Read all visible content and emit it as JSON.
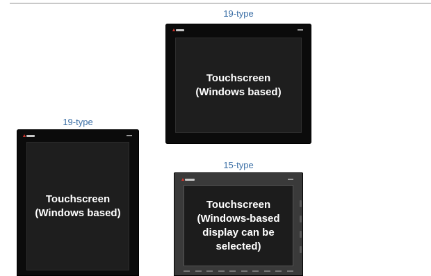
{
  "panels": [
    {
      "caption": "19-type",
      "screen_text": [
        "Touchscreen",
        "(Windows based)"
      ]
    },
    {
      "caption": "19-type",
      "screen_text": [
        "Touchscreen",
        "(Windows based)"
      ]
    },
    {
      "caption": "15-type",
      "screen_text": [
        "Touchscreen",
        "(Windows-based",
        "display can be",
        "selected)"
      ]
    }
  ],
  "colors": {
    "caption": "#3a6ea5",
    "bezel_black": "#0b0b0b",
    "bezel_gray": "#3a3a3a",
    "screen": "#1e1e1e",
    "screen_text": "#ffffff",
    "logo_accent": "#d0342c"
  },
  "icons": [
    "brand-logo-icon"
  ]
}
